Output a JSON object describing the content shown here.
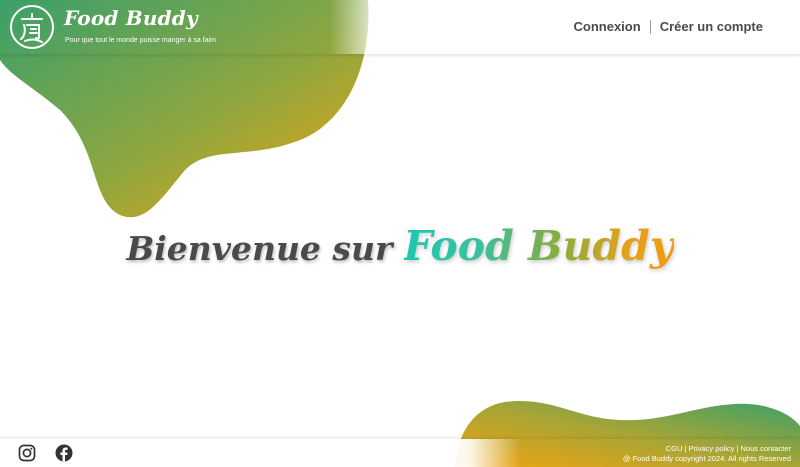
{
  "header": {
    "brand_name": "Food Buddy",
    "tagline": "Pour que tout le monde puisse manger à sa faim",
    "logo_icon": "food-buddy-logo-icon",
    "nav": {
      "login_label": "Connexion",
      "signup_label": "Créer un compte"
    }
  },
  "hero": {
    "lead": "Bienvenue sur",
    "brand": "Food Buddy"
  },
  "footer": {
    "social_icons": [
      "instagram-icon",
      "facebook-icon"
    ],
    "links": {
      "cgu": "CGU",
      "privacy": "Privacy policy",
      "contact": "Nous contacter",
      "separator": "|"
    },
    "copyright": "@ Food Buddy copyright 2024. All rights Reserved"
  },
  "colors": {
    "green": "#3da268",
    "orange": "#f0a510",
    "teal": "#1bc8b2",
    "text_dark": "#4a4a4a"
  }
}
